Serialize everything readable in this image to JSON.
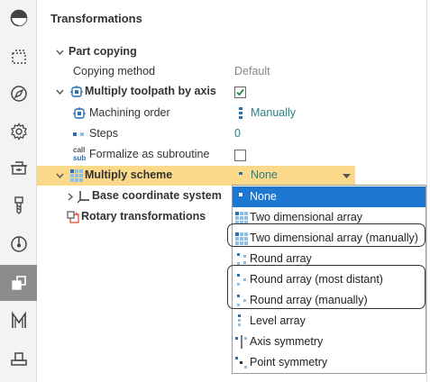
{
  "toolbar": {
    "items": [
      {
        "icon": "yin-yang-icon"
      },
      {
        "icon": "dashed-box-icon"
      },
      {
        "icon": "compass-icon"
      },
      {
        "icon": "gear-icon"
      },
      {
        "icon": "machine-icon"
      },
      {
        "icon": "tool-icon"
      },
      {
        "icon": "spindle-icon"
      },
      {
        "icon": "transformations-icon",
        "active": true
      },
      {
        "icon": "m-letter-icon"
      },
      {
        "icon": "base-icon"
      }
    ]
  },
  "panel": {
    "title": "Transformations",
    "part_copying": {
      "label": "Part copying",
      "copying_method": {
        "label": "Copying method",
        "value": "Default"
      },
      "multiply_toolpath": {
        "label": "Multiply toolpath by axis",
        "checked": true
      },
      "machining_order": {
        "label": "Machining order",
        "value": "Manually"
      },
      "steps": {
        "label": "Steps",
        "value": "0"
      },
      "formalize": {
        "label": "Formalize as subroutine",
        "checked": false,
        "icon_text_top": "call",
        "icon_text_bottom": "sub"
      },
      "multiply_scheme": {
        "label": "Multiply scheme",
        "value": "None"
      },
      "base_coordinate": {
        "label": "Base coordinate system"
      },
      "rotary": {
        "label": "Rotary transformations"
      }
    }
  },
  "dropdown": {
    "options": [
      {
        "label": "None",
        "selected": true
      },
      {
        "label": "Two dimensional array"
      },
      {
        "label": "Two dimensional array (manually)"
      },
      {
        "label": "Round array"
      },
      {
        "label": "Round array (most distant)"
      },
      {
        "label": "Round array (manually)"
      },
      {
        "label": "Level array"
      },
      {
        "label": "Axis symmetry"
      },
      {
        "label": "Point symmetry"
      }
    ]
  },
  "colors": {
    "highlight": "#fbd98a",
    "selection": "#1e78d2",
    "teal_value": "#2a7f86",
    "checkbox_check": "#1c8c3c"
  }
}
